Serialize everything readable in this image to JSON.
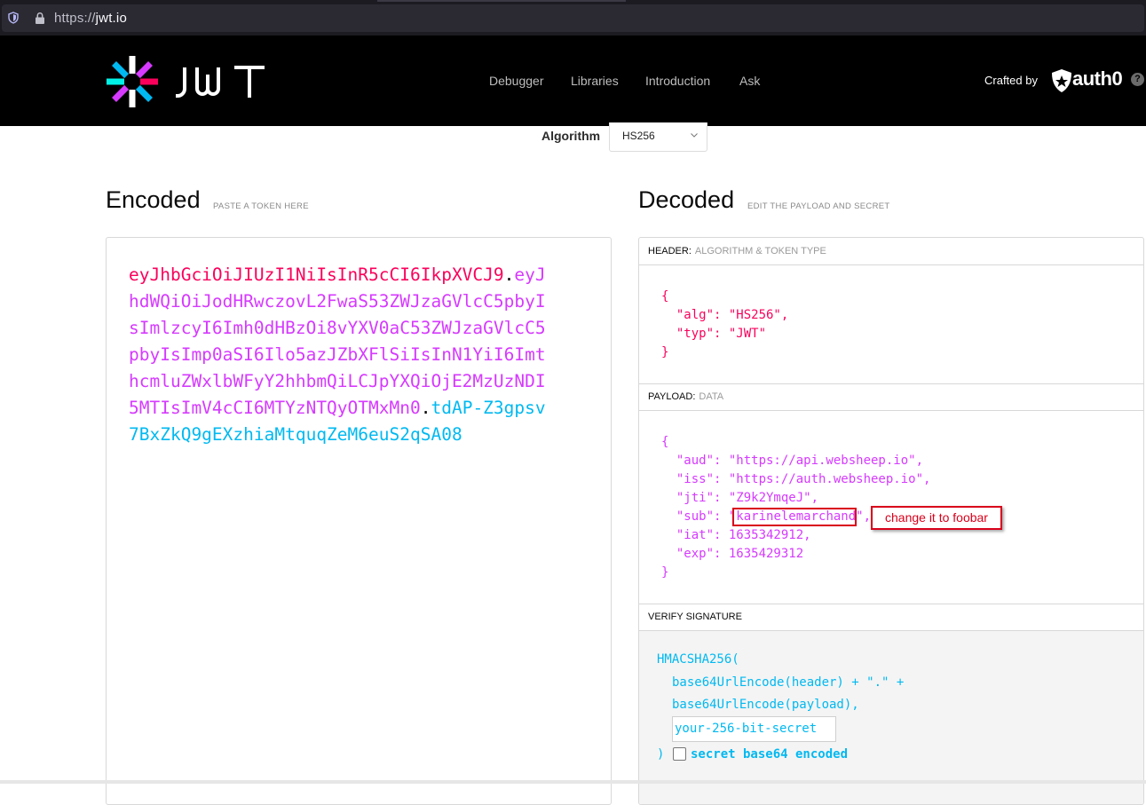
{
  "browser": {
    "url_scheme": "https://",
    "url_host": "jwt.io"
  },
  "header": {
    "nav": [
      "Debugger",
      "Libraries",
      "Introduction",
      "Ask"
    ],
    "crafted_by": "Crafted by",
    "auth0": "auth0",
    "help": "?"
  },
  "algorithm": {
    "label": "Algorithm",
    "value": "HS256"
  },
  "encoded": {
    "title": "Encoded",
    "subtitle": "PASTE A TOKEN HERE",
    "token_header": "eyJhbGciOiJIUzI1NiIsInR5cCI6IkpXVCJ9",
    "token_payload": "eyJhdWQiOiJodHRwczovL2FwaS53ZWJzaGVlcC5pbyIsImlzcyI6Imh0dHBzOi8vYXV0aC53ZWJzaGVlcC5pbyIsImp0aSI6Ilo5azJZbXFlSiIsInN1YiI6ImthcmluZWxlbWFyY2hhbmQiLCJpYXQiOjE2MzUzNDI5MTIsImV4cCI6MTYzNTQyOTMxMn0",
    "token_signature": "tdAP-Z3gpsv7BxZkQ9gEXzhiaMtquqZeM6euS2qSA08",
    "dot": "."
  },
  "decoded": {
    "title": "Decoded",
    "subtitle": "EDIT THE PAYLOAD AND SECRET",
    "header_section": {
      "label": "HEADER:",
      "sub": "ALGORITHM & TOKEN TYPE"
    },
    "header_json": {
      "open": "{",
      "alg_line": "  \"alg\": \"HS256\",",
      "typ_line": "  \"typ\": \"JWT\"",
      "close": "}"
    },
    "payload_section": {
      "label": "PAYLOAD:",
      "sub": "DATA"
    },
    "payload_json": {
      "open": "{",
      "aud_line": "  \"aud\": \"https://api.websheep.io\",",
      "iss_line": "  \"iss\": \"https://auth.websheep.io\",",
      "jti_line": "  \"jti\": \"Z9k2YmqeJ\",",
      "sub_key": "  \"sub\": \"",
      "sub_value": "karinelemarchand",
      "sub_end": "\",",
      "iat_line": "  \"iat\": 1635342912,",
      "exp_line": "  \"exp\": 1635429312",
      "close": "}"
    },
    "annotation": "change it to foobar",
    "verify_section": {
      "label": "VERIFY SIGNATURE"
    },
    "verify": {
      "fn": "HMACSHA256(",
      "line1": "base64UrlEncode(header) + \".\" +",
      "line2": "base64UrlEncode(payload),",
      "secret_placeholder": "your-256-bit-secret",
      "close": ")",
      "checkbox_label": "secret base64 encoded"
    }
  },
  "colors": {
    "header_red": "#fb015b",
    "payload_purple": "#d63aff",
    "signature_blue": "#00b9f1",
    "annotation_red": "#d9001b"
  }
}
